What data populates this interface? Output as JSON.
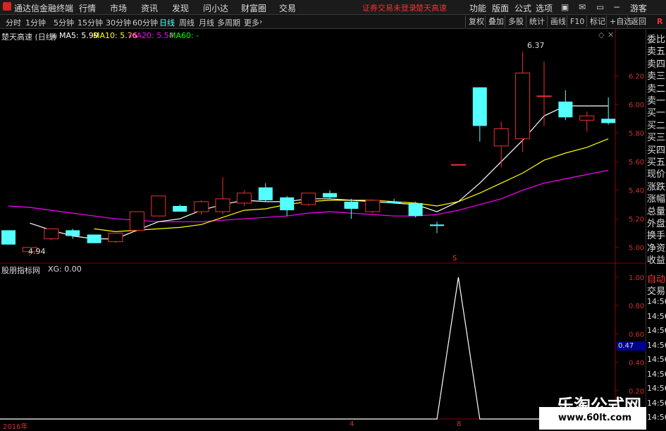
{
  "app": {
    "title": "通达信金融终端"
  },
  "menu": [
    "行情",
    "市场",
    "资讯",
    "发现",
    "问小达",
    "财富圈",
    "交易"
  ],
  "status": {
    "notice": "证券交易未登录",
    "stock_name": "楚天高速"
  },
  "right_menu": [
    "功能",
    "版面",
    "公式",
    "选项"
  ],
  "user": "游客",
  "periods": [
    "分时",
    "1分钟",
    "5分钟",
    "15分钟",
    "30分钟",
    "60分钟",
    "日线",
    "周线",
    "月线",
    "多周期",
    "更多"
  ],
  "active_period": "日线",
  "tools": [
    "复权",
    "叠加",
    "多股",
    "统计",
    "画线",
    "F10",
    "标记",
    "+自选",
    "返回"
  ],
  "indicator": {
    "title": "楚天高速 (日线)",
    "ma5": "MA5: 5.99",
    "ma10": "MA10: 5.76",
    "ma20": "MA20: 5.54",
    "ma60": "MA60: -"
  },
  "annotations": {
    "high": "6.37",
    "low": "4.94",
    "marker_s": "S"
  },
  "price_axis": [
    "6.20",
    "6.00",
    "5.80",
    "5.60",
    "5.40",
    "5.20",
    "5.00"
  ],
  "sub": {
    "title": "股朋指标网",
    "xg": "XG: 0.00",
    "current": "0.47"
  },
  "sub_axis": [
    "1.00",
    "0.80",
    "0.60",
    "0.40",
    "0.20"
  ],
  "date_labels": [
    "2016年",
    "4",
    "8"
  ],
  "side_panel": [
    "委比",
    "卖五",
    "卖四",
    "卖三",
    "卖二",
    "卖一",
    "买一",
    "买二",
    "买三",
    "买四",
    "买五",
    "现价",
    "涨跌",
    "涨幅",
    "总量",
    "外盘",
    "换手",
    "净资",
    "收益"
  ],
  "side_panel2": [
    "自动",
    "交易"
  ],
  "side_times": [
    "14:56",
    "14:56",
    "14:56",
    "14:56",
    "14:56",
    "14:56",
    "14:56",
    "14:56",
    "14:56"
  ],
  "watermark": {
    "title": "乐淘公式网",
    "url": "www.60lt.com"
  },
  "colors": {
    "up": "#f03030",
    "down": "#54ffff",
    "ma5": "#ffffff",
    "ma10": "#ffff00",
    "ma20": "#ff00ff",
    "grid": "#8b0000"
  },
  "chart_data": {
    "type": "candlestick",
    "price_range": [
      4.9,
      6.45
    ],
    "candles": [
      {
        "o": 5.12,
        "h": 5.12,
        "l": 5.02,
        "c": 5.02,
        "ma5": null,
        "ma10": null,
        "ma20": 5.29
      },
      {
        "o": 4.97,
        "h": 5.0,
        "l": 4.94,
        "c": 5.0,
        "ma5": 5.17,
        "ma10": null,
        "ma20": 5.28
      },
      {
        "o": 5.06,
        "h": 5.13,
        "l": 5.05,
        "c": 5.13,
        "ma5": 5.12,
        "ma10": null,
        "ma20": 5.26
      },
      {
        "o": 5.12,
        "h": 5.13,
        "l": 5.06,
        "c": 5.08,
        "ma5": 5.08,
        "ma10": null,
        "ma20": 5.24
      },
      {
        "o": 5.09,
        "h": 5.09,
        "l": 5.03,
        "c": 5.03,
        "ma5": 5.06,
        "ma10": 5.13,
        "ma20": 5.22
      },
      {
        "o": 5.04,
        "h": 5.1,
        "l": 5.03,
        "c": 5.1,
        "ma5": 5.06,
        "ma10": 5.11,
        "ma20": 5.2
      },
      {
        "o": 5.12,
        "h": 5.25,
        "l": 5.11,
        "c": 5.25,
        "ma5": 5.12,
        "ma10": 5.12,
        "ma20": 5.19
      },
      {
        "o": 5.22,
        "h": 5.36,
        "l": 5.22,
        "c": 5.36,
        "ma5": 5.18,
        "ma10": 5.13,
        "ma20": 5.18
      },
      {
        "o": 5.29,
        "h": 5.3,
        "l": 5.25,
        "c": 5.25,
        "ma5": 5.2,
        "ma10": 5.14,
        "ma20": 5.18
      },
      {
        "o": 5.25,
        "h": 5.33,
        "l": 5.23,
        "c": 5.32,
        "ma5": 5.26,
        "ma10": 5.16,
        "ma20": 5.18
      },
      {
        "o": 5.25,
        "h": 5.49,
        "l": 5.23,
        "c": 5.34,
        "ma5": 5.3,
        "ma10": 5.21,
        "ma20": 5.19
      },
      {
        "o": 5.31,
        "h": 5.4,
        "l": 5.29,
        "c": 5.38,
        "ma5": 5.33,
        "ma10": 5.26,
        "ma20": 5.2
      },
      {
        "o": 5.42,
        "h": 5.45,
        "l": 5.32,
        "c": 5.33,
        "ma5": 5.32,
        "ma10": 5.27,
        "ma20": 5.21
      },
      {
        "o": 5.35,
        "h": 5.36,
        "l": 5.22,
        "c": 5.26,
        "ma5": 5.32,
        "ma10": 5.3,
        "ma20": 5.22
      },
      {
        "o": 5.3,
        "h": 5.38,
        "l": 5.29,
        "c": 5.38,
        "ma5": 5.34,
        "ma10": 5.32,
        "ma20": 5.24
      },
      {
        "o": 5.38,
        "h": 5.4,
        "l": 5.34,
        "c": 5.35,
        "ma5": 5.34,
        "ma10": 5.33,
        "ma20": 5.25
      },
      {
        "o": 5.32,
        "h": 5.34,
        "l": 5.2,
        "c": 5.27,
        "ma5": 5.33,
        "ma10": 5.33,
        "ma20": 5.24
      },
      {
        "o": 5.25,
        "h": 5.33,
        "l": 5.24,
        "c": 5.33,
        "ma5": 5.32,
        "ma10": 5.33,
        "ma20": 5.23
      },
      {
        "o": 5.32,
        "h": 5.34,
        "l": 5.31,
        "c": 5.31,
        "ma5": 5.31,
        "ma10": 5.32,
        "ma20": 5.22
      },
      {
        "o": 5.31,
        "h": 5.32,
        "l": 5.21,
        "c": 5.22,
        "ma5": 5.3,
        "ma10": 5.31,
        "ma20": 5.22
      },
      {
        "o": 5.16,
        "h": 5.18,
        "l": 5.1,
        "c": 5.15,
        "ma5": 5.25,
        "ma10": 5.29,
        "ma20": 5.23
      },
      {
        "o": 5.58,
        "h": 5.58,
        "l": 5.58,
        "c": 5.58,
        "ma5": 5.32,
        "ma10": 5.32,
        "ma20": 5.26
      },
      {
        "o": 6.12,
        "h": 6.12,
        "l": 5.74,
        "c": 5.85,
        "ma5": 5.45,
        "ma10": 5.38,
        "ma20": 5.3
      },
      {
        "o": 5.71,
        "h": 5.88,
        "l": 5.56,
        "c": 5.83,
        "ma5": 5.6,
        "ma10": 5.45,
        "ma20": 5.34
      },
      {
        "o": 5.76,
        "h": 6.37,
        "l": 5.67,
        "c": 6.22,
        "ma5": 5.75,
        "ma10": 5.52,
        "ma20": 5.4
      },
      {
        "o": 6.06,
        "h": 6.3,
        "l": 5.85,
        "c": 6.06,
        "ma5": 5.92,
        "ma10": 5.61,
        "ma20": 5.45
      },
      {
        "o": 6.02,
        "h": 6.1,
        "l": 5.89,
        "c": 5.91,
        "ma5": 5.99,
        "ma10": 5.66,
        "ma20": 5.48
      },
      {
        "o": 5.89,
        "h": 5.95,
        "l": 5.81,
        "c": 5.92,
        "ma5": 5.99,
        "ma10": 5.7,
        "ma20": 5.51
      },
      {
        "o": 5.9,
        "h": 6.05,
        "l": 5.86,
        "c": 5.87,
        "ma5": 5.99,
        "ma10": 5.76,
        "ma20": 5.54
      }
    ],
    "xg_series": [
      0,
      0,
      0,
      0,
      0,
      0,
      0,
      0,
      0,
      0,
      0,
      0,
      0,
      0,
      0,
      0,
      0,
      0,
      0,
      0,
      0,
      1,
      0,
      0,
      0,
      0,
      0,
      0,
      0
    ],
    "sub_range": [
      0,
      1
    ]
  }
}
